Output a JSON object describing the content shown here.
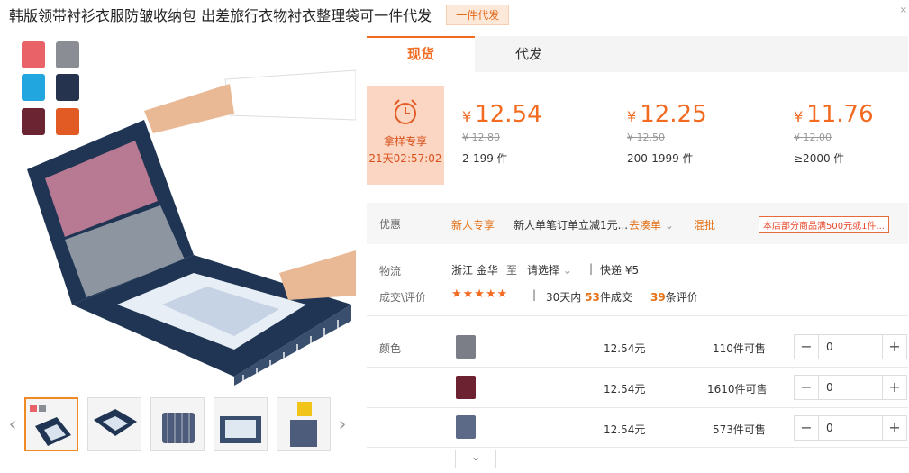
{
  "header": {
    "title": "韩版领带衬衫衣服防皱收纳包 出差旅行衣物衬衣整理袋可一件代发",
    "badge": "一件代发",
    "close": "×"
  },
  "gallery": {
    "prev": "‹",
    "next": "›",
    "swatch_colors": [
      "#e86268",
      "#8a8d93",
      "#22a6df",
      "#26334f",
      "#6a2432",
      "#e25b24"
    ]
  },
  "tabs": [
    {
      "label": "现货",
      "active": true
    },
    {
      "label": "代发",
      "active": false
    }
  ],
  "promo": {
    "label": "拿样专享",
    "timer": "21天02:57:02"
  },
  "tiers": [
    {
      "currency": "¥",
      "price": "12.54",
      "orig": "¥ 12.80",
      "range": "2-199 件"
    },
    {
      "currency": "¥",
      "price": "12.25",
      "orig": "¥ 12.50",
      "range": "200-1999 件"
    },
    {
      "currency": "¥",
      "price": "11.76",
      "orig": "¥ 12.00",
      "range": "≥2000 件"
    }
  ],
  "offers": {
    "label": "优惠",
    "new_user": "新人专享",
    "new_user_text": "新人单笔订单立减1元...",
    "go": "去凑单",
    "mixed": "混批",
    "coupon": "本店部分商品满500元或1件..."
  },
  "logistics": {
    "label": "物流",
    "from": "浙江 金华",
    "to_word": "至",
    "select": "请选择",
    "divider": "|",
    "express": "快递 ¥5"
  },
  "reviews": {
    "label": "成交\\评价",
    "stars": "★★★★★",
    "sep": "|",
    "sold_pre": "30天内",
    "sold_num": "53",
    "sold_post": "件成交",
    "review_num": "39",
    "review_post": "条评价"
  },
  "sku": {
    "label": "颜色",
    "items": [
      {
        "color": "#7b7e87",
        "price": "12.54元",
        "stock": "110件可售",
        "qty": "0"
      },
      {
        "color": "#6d2231",
        "price": "12.54元",
        "stock": "1610件可售",
        "qty": "0"
      },
      {
        "color": "#5c6a88",
        "price": "12.54元",
        "stock": "573件可售",
        "qty": "0"
      }
    ],
    "minus": "−",
    "plus": "+",
    "more": "⌄"
  }
}
